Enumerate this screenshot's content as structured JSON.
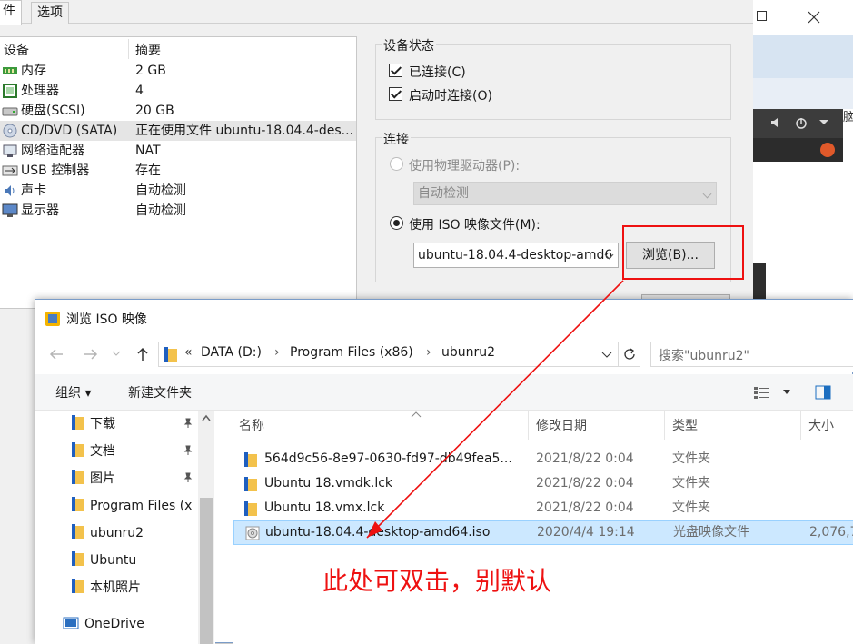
{
  "vm": {
    "tabs": [
      "件",
      "选项"
    ],
    "list_header": {
      "device": "设备",
      "summary": "摘要"
    },
    "devices": [
      {
        "name": "内存",
        "summary": "2 GB",
        "icon": "memory-icon"
      },
      {
        "name": "处理器",
        "summary": "4",
        "icon": "cpu-icon"
      },
      {
        "name": "硬盘(SCSI)",
        "summary": "20 GB",
        "icon": "harddisk-icon"
      },
      {
        "name": "CD/DVD (SATA)",
        "summary": "正在使用文件 ubuntu-18.04.4-des...",
        "icon": "cd-icon"
      },
      {
        "name": "网络适配器",
        "summary": "NAT",
        "icon": "network-icon"
      },
      {
        "name": "USB 控制器",
        "summary": "存在",
        "icon": "usb-icon"
      },
      {
        "name": "声卡",
        "summary": "自动检测",
        "icon": "sound-icon"
      },
      {
        "name": "显示器",
        "summary": "自动检测",
        "icon": "monitor-icon"
      }
    ],
    "status_group": {
      "title": "设备状态",
      "connected": "已连接(C)",
      "connect_on_start": "启动时连接(O)"
    },
    "connection_group": {
      "title": "连接",
      "physical_drive": "使用物理驱动器(P):",
      "physical_select": "自动检测",
      "iso_option": "使用 ISO 映像文件(M):",
      "iso_value": "ubuntu-18.04.4-desktop-amd6",
      "browse": "浏览(B)..."
    },
    "preview_text": "脑"
  },
  "dialog": {
    "title": "浏览 ISO 映像",
    "breadcrumb": [
      "«",
      "DATA (D:)",
      "Program Files (x86)",
      "ubunru2"
    ],
    "search_placeholder": "搜索\"ubunru2\"",
    "toolbar": {
      "organize": "组织 ▾",
      "new_folder": "新建文件夹"
    },
    "nav_items": [
      {
        "label": "下载",
        "pinned": true
      },
      {
        "label": "文档",
        "pinned": true
      },
      {
        "label": "图片",
        "pinned": true
      },
      {
        "label": "Program Files (x",
        "pinned": false
      },
      {
        "label": "ubunru2",
        "pinned": false
      },
      {
        "label": "Ubuntu",
        "pinned": false
      },
      {
        "label": "本机照片",
        "pinned": false
      },
      {
        "label": "OneDrive",
        "pinned": false
      }
    ],
    "columns": {
      "name": "名称",
      "date": "修改日期",
      "type": "类型",
      "size": "大小"
    },
    "files": [
      {
        "name": "564d9c56-8e97-0630-fd97-db49fea5...",
        "date": "2021/8/22 0:04",
        "type": "文件夹",
        "size": "",
        "icon": "folder-icon"
      },
      {
        "name": "Ubuntu 18.vmdk.lck",
        "date": "2021/8/22 0:04",
        "type": "文件夹",
        "size": "",
        "icon": "folder-icon"
      },
      {
        "name": "Ubuntu 18.vmx.lck",
        "date": "2021/8/22 0:04",
        "type": "文件夹",
        "size": "",
        "icon": "folder-icon"
      },
      {
        "name": "ubuntu-18.04.4-desktop-amd64.iso",
        "date": "2020/4/4 19:14",
        "type": "光盘映像文件",
        "size": "2,076,7",
        "icon": "disc-image-icon"
      }
    ]
  },
  "annotation": "此处可双击，别默认",
  "colors": {
    "accent_red": "#ee1111",
    "selection": "#cce8ff"
  }
}
